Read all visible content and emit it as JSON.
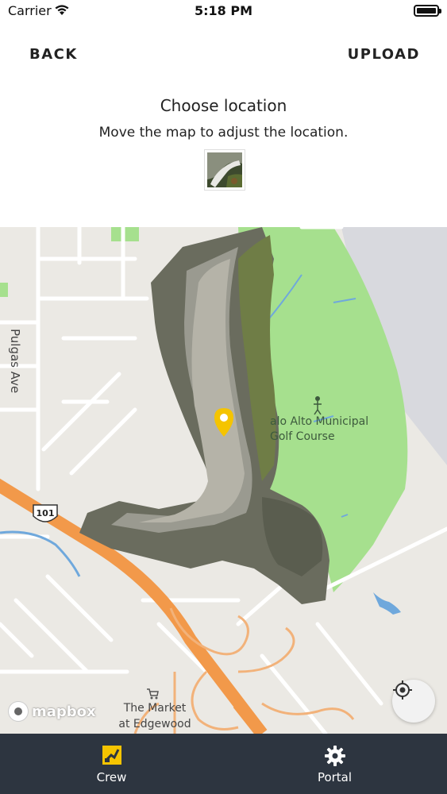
{
  "status_bar": {
    "carrier": "Carrier",
    "time": "5:18 PM"
  },
  "header": {
    "back_label": "BACK",
    "upload_label": "UPLOAD",
    "title": "Choose location",
    "subtitle": "Move the map to adjust the location."
  },
  "map": {
    "street_label": "Pulgas Ave",
    "highway_shield": "101",
    "poi_golf": "alo Alto Municipal\nGolf Course",
    "poi_market": "The Market\nat Edgewood",
    "attribution": "mapbox",
    "pin_color": "#f5c400",
    "park_color": "#a6e08e",
    "highway_color": "#f2994a"
  },
  "tabbar": {
    "tabs": [
      {
        "label": "Crew",
        "icon": "crew-icon",
        "active": true
      },
      {
        "label": "Portal",
        "icon": "gear-icon",
        "active": false
      }
    ]
  }
}
